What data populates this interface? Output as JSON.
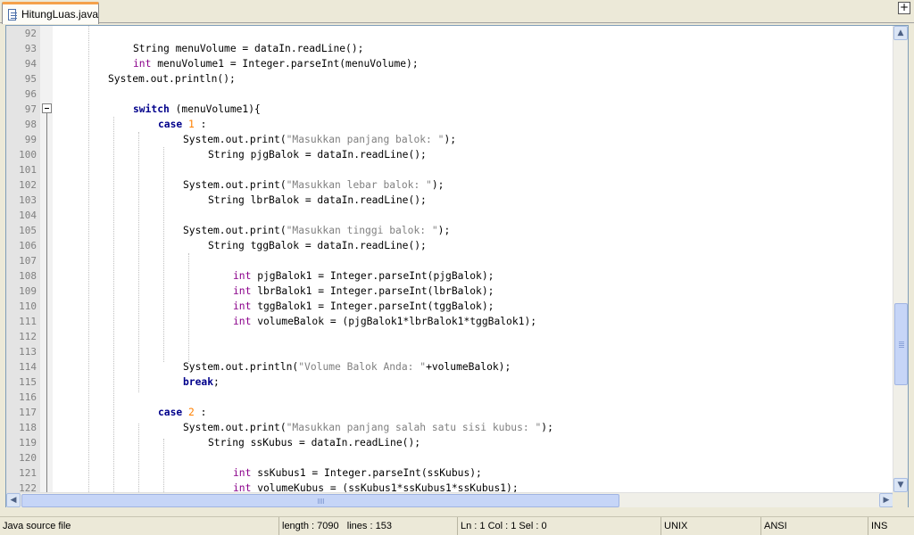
{
  "tabs": [
    {
      "label": "HitungLuas.java",
      "active": true
    }
  ],
  "colors": {
    "keyword": "#00008b",
    "type": "#8b008b",
    "string": "#808080",
    "number": "#ff8000",
    "tab_accent": "#f5a14a"
  },
  "editor": {
    "lines": [
      {
        "num": "92",
        "indent": 0,
        "tokens": []
      },
      {
        "num": "93",
        "indent": 12,
        "tokens": [
          {
            "t": "String menuVolume = dataIn.readLine();"
          }
        ]
      },
      {
        "num": "94",
        "indent": 12,
        "tokens": [
          {
            "t": "int",
            "c": "ty"
          },
          {
            "t": " menuVolume1 = Integer.parseInt(menuVolume);"
          }
        ]
      },
      {
        "num": "95",
        "indent": 8,
        "tokens": [
          {
            "t": "System.out.println();"
          }
        ]
      },
      {
        "num": "96",
        "indent": 0,
        "tokens": []
      },
      {
        "num": "97",
        "indent": 12,
        "tokens": [
          {
            "t": "switch",
            "c": "kw"
          },
          {
            "t": " (menuVolume1){"
          }
        ]
      },
      {
        "num": "98",
        "indent": 16,
        "tokens": [
          {
            "t": "case",
            "c": "kw"
          },
          {
            "t": " "
          },
          {
            "t": "1",
            "c": "num"
          },
          {
            "t": " :"
          }
        ]
      },
      {
        "num": "99",
        "indent": 20,
        "tokens": [
          {
            "t": "System.out.print("
          },
          {
            "t": "\"Masukkan panjang balok: \"",
            "c": "str"
          },
          {
            "t": ");"
          }
        ]
      },
      {
        "num": "100",
        "indent": 24,
        "tokens": [
          {
            "t": "String pjgBalok = dataIn.readLine();"
          }
        ]
      },
      {
        "num": "101",
        "indent": 0,
        "tokens": []
      },
      {
        "num": "102",
        "indent": 20,
        "tokens": [
          {
            "t": "System.out.print("
          },
          {
            "t": "\"Masukkan lebar balok: \"",
            "c": "str"
          },
          {
            "t": ");"
          }
        ]
      },
      {
        "num": "103",
        "indent": 24,
        "tokens": [
          {
            "t": "String lbrBalok = dataIn.readLine();"
          }
        ]
      },
      {
        "num": "104",
        "indent": 0,
        "tokens": []
      },
      {
        "num": "105",
        "indent": 20,
        "tokens": [
          {
            "t": "System.out.print("
          },
          {
            "t": "\"Masukkan tinggi balok: \"",
            "c": "str"
          },
          {
            "t": ");"
          }
        ]
      },
      {
        "num": "106",
        "indent": 24,
        "tokens": [
          {
            "t": "String tggBalok = dataIn.readLine();"
          }
        ]
      },
      {
        "num": "107",
        "indent": 0,
        "tokens": []
      },
      {
        "num": "108",
        "indent": 28,
        "tokens": [
          {
            "t": "int",
            "c": "ty"
          },
          {
            "t": " pjgBalok1 = Integer.parseInt(pjgBalok);"
          }
        ]
      },
      {
        "num": "109",
        "indent": 28,
        "tokens": [
          {
            "t": "int",
            "c": "ty"
          },
          {
            "t": " lbrBalok1 = Integer.parseInt(lbrBalok);"
          }
        ]
      },
      {
        "num": "110",
        "indent": 28,
        "tokens": [
          {
            "t": "int",
            "c": "ty"
          },
          {
            "t": " tggBalok1 = Integer.parseInt(tggBalok);"
          }
        ]
      },
      {
        "num": "111",
        "indent": 28,
        "tokens": [
          {
            "t": "int",
            "c": "ty"
          },
          {
            "t": " volumeBalok = (pjgBalok1*lbrBalok1*tggBalok1);"
          }
        ]
      },
      {
        "num": "112",
        "indent": 0,
        "tokens": []
      },
      {
        "num": "113",
        "indent": 0,
        "tokens": []
      },
      {
        "num": "114",
        "indent": 20,
        "tokens": [
          {
            "t": "System.out.println("
          },
          {
            "t": "\"Volume Balok Anda: \"",
            "c": "str"
          },
          {
            "t": "+volumeBalok);"
          }
        ]
      },
      {
        "num": "115",
        "indent": 20,
        "tokens": [
          {
            "t": "break",
            "c": "kw"
          },
          {
            "t": ";"
          }
        ]
      },
      {
        "num": "116",
        "indent": 0,
        "tokens": []
      },
      {
        "num": "117",
        "indent": 16,
        "tokens": [
          {
            "t": "case",
            "c": "kw"
          },
          {
            "t": " "
          },
          {
            "t": "2",
            "c": "num"
          },
          {
            "t": " :"
          }
        ]
      },
      {
        "num": "118",
        "indent": 20,
        "tokens": [
          {
            "t": "System.out.print("
          },
          {
            "t": "\"Masukkan panjang salah satu sisi kubus: \"",
            "c": "str"
          },
          {
            "t": ");"
          }
        ]
      },
      {
        "num": "119",
        "indent": 24,
        "tokens": [
          {
            "t": "String ssKubus = dataIn.readLine();"
          }
        ]
      },
      {
        "num": "120",
        "indent": 0,
        "tokens": []
      },
      {
        "num": "121",
        "indent": 28,
        "tokens": [
          {
            "t": "int",
            "c": "ty"
          },
          {
            "t": " ssKubus1 = Integer.parseInt(ssKubus);"
          }
        ]
      },
      {
        "num": "122",
        "indent": 28,
        "tokens": [
          {
            "t": "int",
            "c": "ty"
          },
          {
            "t": " volumeKubus = (ssKubus1*ssKubus1*ssKubus1);"
          }
        ]
      }
    ]
  },
  "scrollbars": {
    "vertical": {
      "up_icon": "▲",
      "down_icon": "▼",
      "position_fraction": 0.62
    },
    "horizontal": {
      "left_icon": "◀",
      "right_icon": "▶",
      "position_fraction": 0.0
    }
  },
  "status": {
    "file_type": "Java source file",
    "length": "length : 7090",
    "lines": "lines : 153",
    "position": "Ln : 1    Col : 1    Sel : 0",
    "eol": "UNIX",
    "encoding": "ANSI",
    "mode": "INS"
  }
}
